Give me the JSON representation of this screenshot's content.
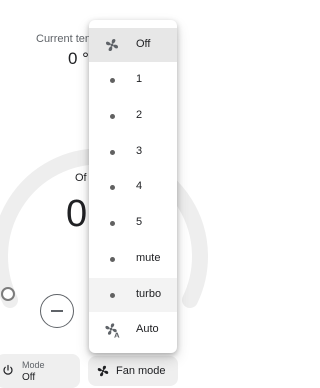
{
  "climate": {
    "current_label": "Current ten",
    "current_value": "0 °",
    "mode_label": "Of",
    "target_value": "0"
  },
  "mode_chip": {
    "label": "Mode",
    "value": "Off"
  },
  "fan_chip": {
    "label": "Fan mode"
  },
  "menu": {
    "items": [
      {
        "label": "Off",
        "icon": "fan-icon",
        "selected": true
      },
      {
        "label": "1",
        "icon": "dot-icon"
      },
      {
        "label": "2",
        "icon": "dot-icon"
      },
      {
        "label": "3",
        "icon": "dot-icon"
      },
      {
        "label": "4",
        "icon": "dot-icon"
      },
      {
        "label": "5",
        "icon": "dot-icon"
      },
      {
        "label": "mute",
        "icon": "dot-icon"
      },
      {
        "label": "turbo",
        "icon": "dot-icon",
        "hovered": true
      },
      {
        "label": "Auto",
        "icon": "fan-auto-icon"
      }
    ]
  },
  "colors": {
    "selected_bg": "#e7e7e7",
    "ring": "#eeeeee",
    "chip_bg": "#efefef"
  }
}
